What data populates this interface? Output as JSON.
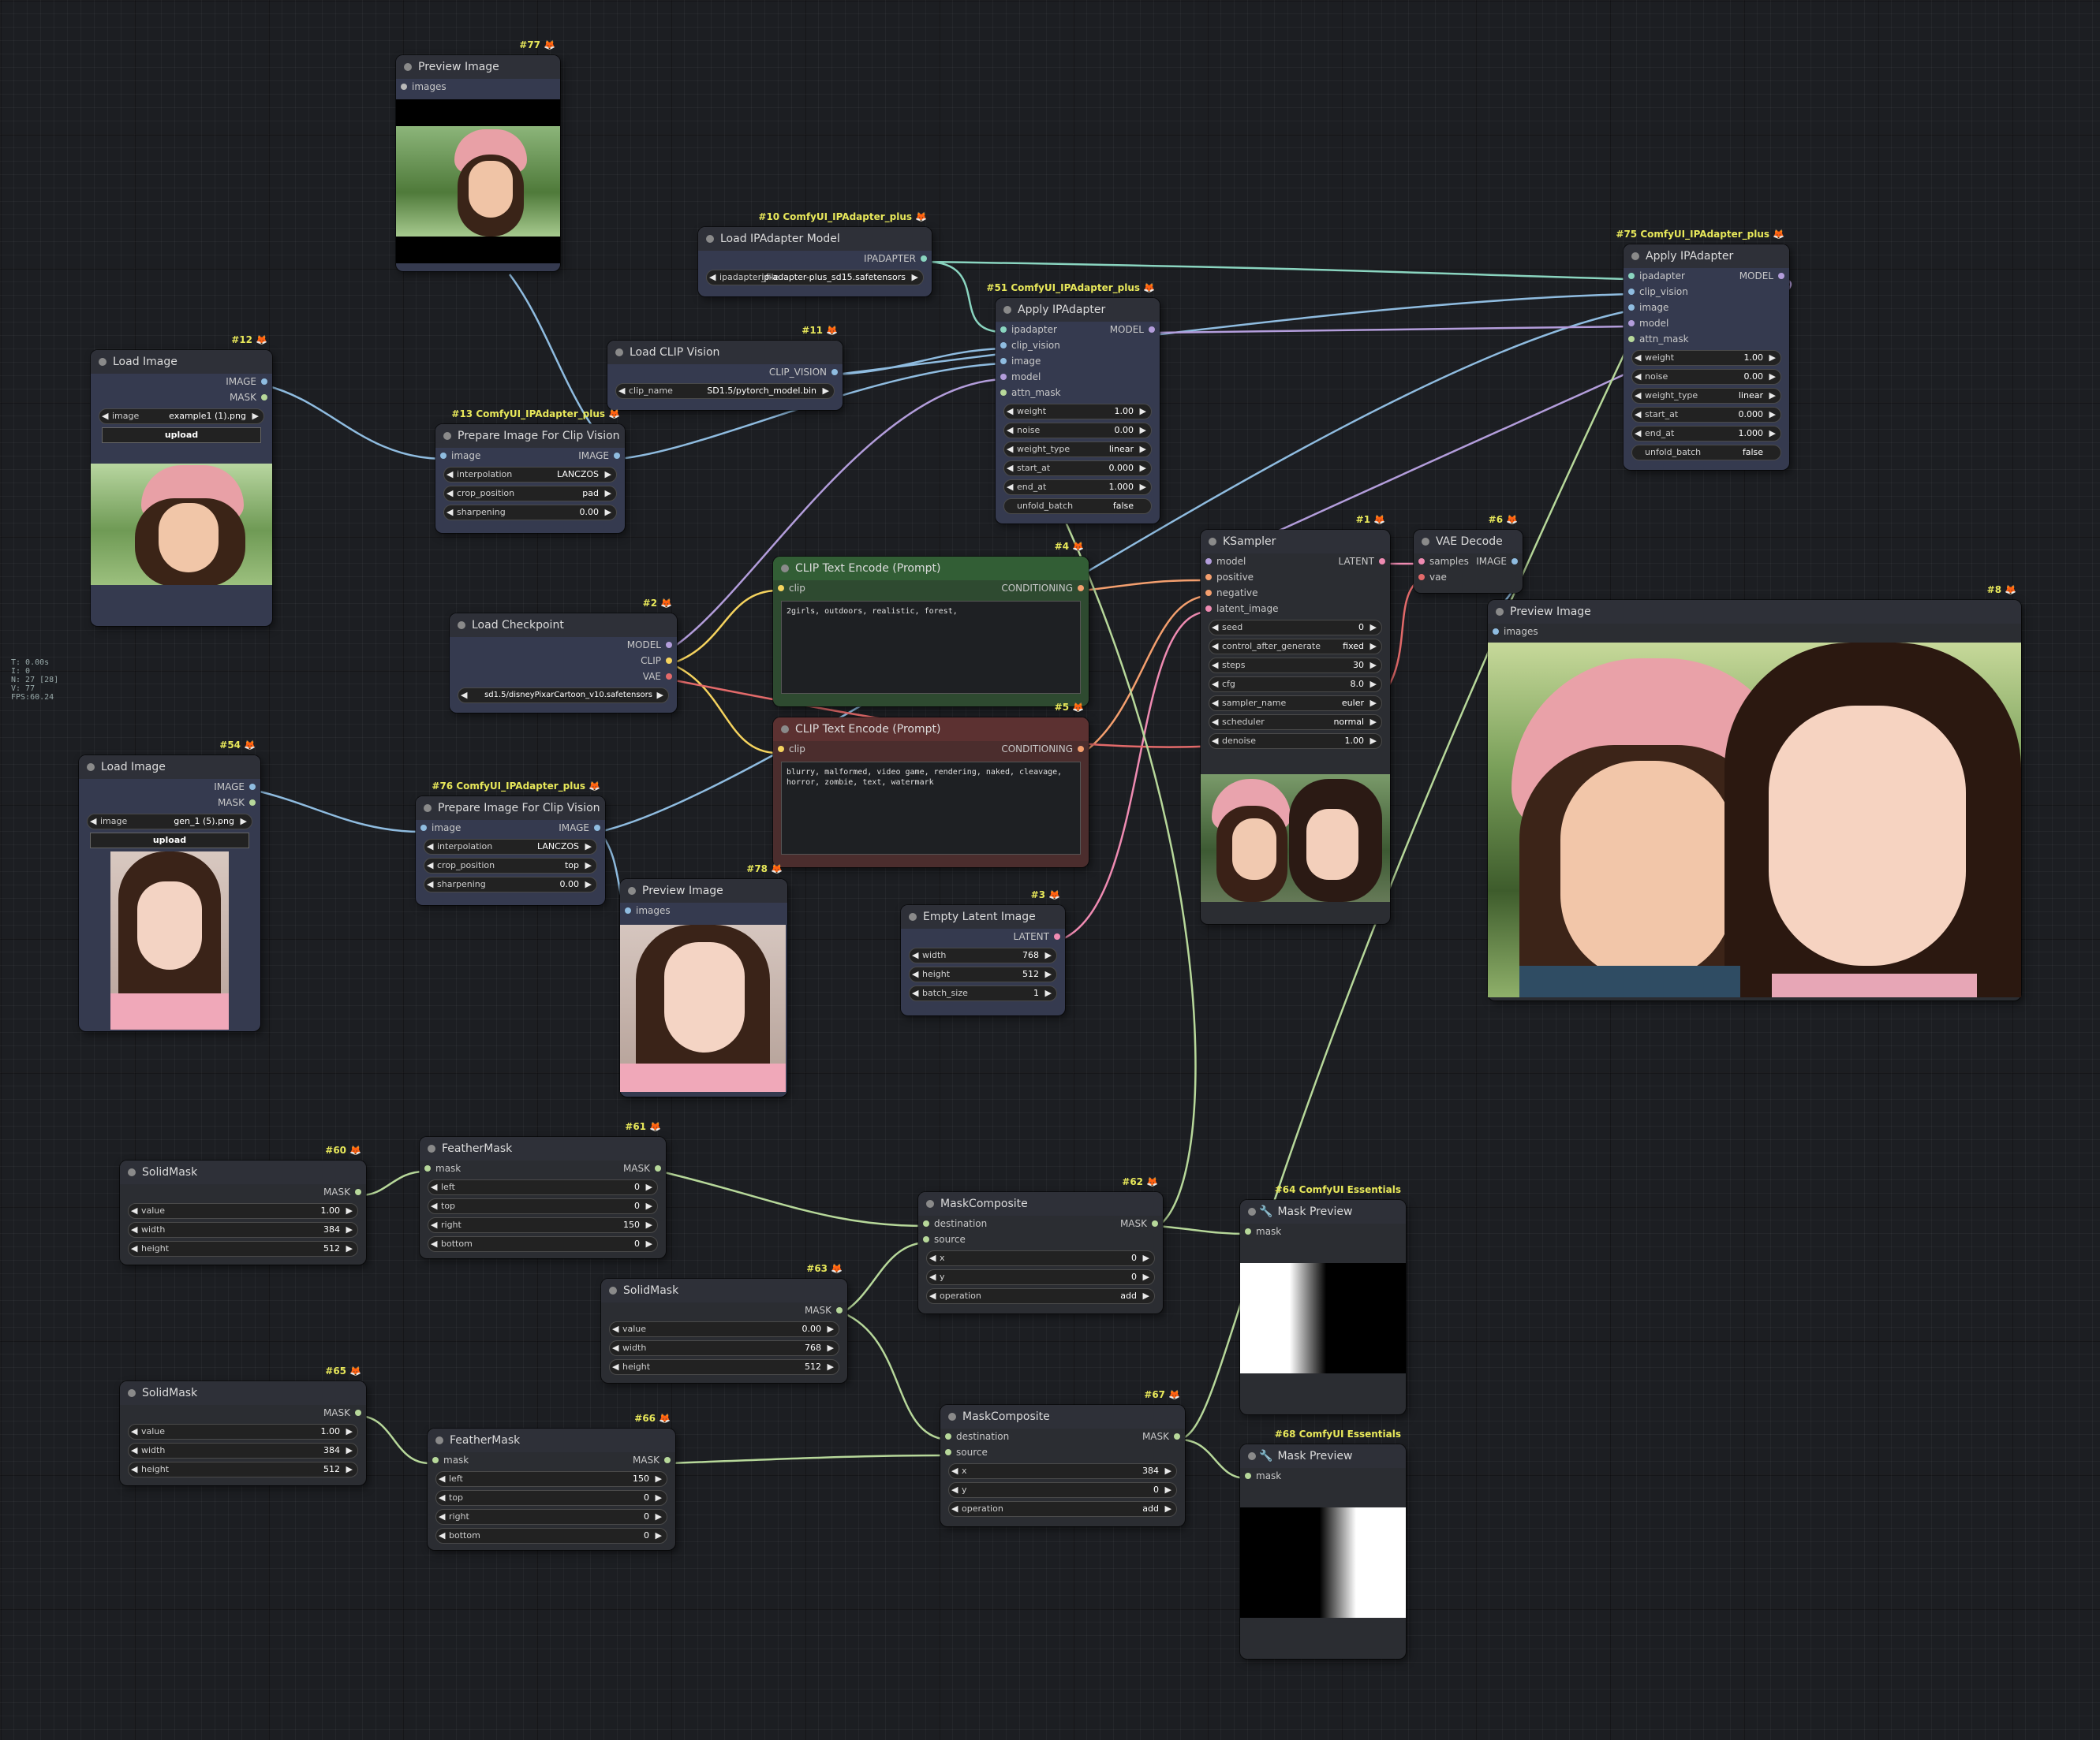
{
  "stats": [
    "T: 0.00s",
    "I: 0",
    "N: 27 [28]",
    "V: 77",
    "FPS:60.24"
  ],
  "colors": {
    "canvas": "#1c1e22",
    "node_body": "#353a4f",
    "node_title": "#2e3038",
    "id_badge": "#e8e85a",
    "link_image": "#8fbce0",
    "link_model": "#b39ddb",
    "link_clip": "#f5d35e",
    "link_conditioning": "#f49f6e",
    "link_latent": "#ef8bb2",
    "link_mask": "#b7d89a",
    "link_ipadapter": "#8ad5c0"
  },
  "nodes": {
    "n77": {
      "id": "#77",
      "title": "Preview Image",
      "in0": "images"
    },
    "n10": {
      "id": "#10 ComfyUI_IPAdapter_plus",
      "title": "Load IPAdapter Model",
      "out0": "IPADAPTER",
      "w_label": "ipadapter_file",
      "w_value": "ip-adapter-plus_sd15.safetensors"
    },
    "n51": {
      "id": "#51 ComfyUI_IPAdapter_plus",
      "title": "Apply IPAdapter",
      "in": [
        "ipadapter",
        "clip_vision",
        "image",
        "model",
        "attn_mask"
      ],
      "out0": "MODEL",
      "widgets": [
        {
          "l": "weight",
          "v": "1.00"
        },
        {
          "l": "noise",
          "v": "0.00"
        },
        {
          "l": "weight_type",
          "v": "linear"
        },
        {
          "l": "start_at",
          "v": "0.000"
        },
        {
          "l": "end_at",
          "v": "1.000"
        }
      ],
      "toggle_l": "unfold_batch",
      "toggle_v": "false"
    },
    "n75": {
      "id": "#75 ComfyUI_IPAdapter_plus",
      "title": "Apply IPAdapter",
      "in": [
        "ipadapter",
        "clip_vision",
        "image",
        "model",
        "attn_mask"
      ],
      "out0": "MODEL",
      "widgets": [
        {
          "l": "weight",
          "v": "1.00"
        },
        {
          "l": "noise",
          "v": "0.00"
        },
        {
          "l": "weight_type",
          "v": "linear"
        },
        {
          "l": "start_at",
          "v": "0.000"
        },
        {
          "l": "end_at",
          "v": "1.000"
        }
      ],
      "toggle_l": "unfold_batch",
      "toggle_v": "false"
    },
    "n11": {
      "id": "#11",
      "title": "Load CLIP Vision",
      "out0": "CLIP_VISION",
      "w_label": "clip_name",
      "w_value": "SD1.5/pytorch_model.bin"
    },
    "n12": {
      "id": "#12",
      "title": "Load Image",
      "out0": "IMAGE",
      "out1": "MASK",
      "w_label": "image",
      "w_value": "example1 (1).png",
      "upload": "upload"
    },
    "n13": {
      "id": "#13 ComfyUI_IPAdapter_plus",
      "title": "Prepare Image For Clip Vision",
      "in0": "image",
      "out0": "IMAGE",
      "widgets": [
        {
          "l": "interpolation",
          "v": "LANCZOS"
        },
        {
          "l": "crop_position",
          "v": "pad"
        },
        {
          "l": "sharpening",
          "v": "0.00"
        }
      ]
    },
    "n2": {
      "id": "#2",
      "title": "Load Checkpoint",
      "out": [
        "MODEL",
        "CLIP",
        "VAE"
      ],
      "w_label": "ckpt_name",
      "w_value": "sd1.5/disneyPixarCartoon_v10.safetensors"
    },
    "n4": {
      "id": "#4",
      "title": "CLIP Text Encode (Prompt)",
      "in0": "clip",
      "out0": "CONDITIONING",
      "text": "2girls, outdoors, realistic, forest,"
    },
    "n5": {
      "id": "#5",
      "title": "CLIP Text Encode (Prompt)",
      "in0": "clip",
      "out0": "CONDITIONING",
      "text": "blurry, malformed, video game, rendering, naked, cleavage, horror, zombie, text, watermark"
    },
    "n1": {
      "id": "#1",
      "title": "KSampler",
      "in": [
        "model",
        "positive",
        "negative",
        "latent_image"
      ],
      "out0": "LATENT",
      "widgets": [
        {
          "l": "seed",
          "v": "0"
        },
        {
          "l": "control_after_generate",
          "v": "fixed"
        },
        {
          "l": "steps",
          "v": "30"
        },
        {
          "l": "cfg",
          "v": "8.0"
        },
        {
          "l": "sampler_name",
          "v": "euler"
        },
        {
          "l": "scheduler",
          "v": "normal"
        },
        {
          "l": "denoise",
          "v": "1.00"
        }
      ]
    },
    "n6": {
      "id": "#6",
      "title": "VAE Decode",
      "in": [
        "samples",
        "vae"
      ],
      "out0": "IMAGE"
    },
    "n8": {
      "id": "#8",
      "title": "Preview Image",
      "in0": "images"
    },
    "n54": {
      "id": "#54",
      "title": "Load Image",
      "out0": "IMAGE",
      "out1": "MASK",
      "w_label": "image",
      "w_value": "gen_1 (5).png",
      "upload": "upload"
    },
    "n76": {
      "id": "#76 ComfyUI_IPAdapter_plus",
      "title": "Prepare Image For Clip Vision",
      "in0": "image",
      "out0": "IMAGE",
      "widgets": [
        {
          "l": "interpolation",
          "v": "LANCZOS"
        },
        {
          "l": "crop_position",
          "v": "top"
        },
        {
          "l": "sharpening",
          "v": "0.00"
        }
      ]
    },
    "n78": {
      "id": "#78",
      "title": "Preview Image",
      "in0": "images"
    },
    "n3": {
      "id": "#3",
      "title": "Empty Latent Image",
      "out0": "LATENT",
      "widgets": [
        {
          "l": "width",
          "v": "768"
        },
        {
          "l": "height",
          "v": "512"
        },
        {
          "l": "batch_size",
          "v": "1"
        }
      ]
    },
    "n60": {
      "id": "#60",
      "title": "SolidMask",
      "out0": "MASK",
      "widgets": [
        {
          "l": "value",
          "v": "1.00"
        },
        {
          "l": "width",
          "v": "384"
        },
        {
          "l": "height",
          "v": "512"
        }
      ]
    },
    "n61": {
      "id": "#61",
      "title": "FeatherMask",
      "in0": "mask",
      "out0": "MASK",
      "widgets": [
        {
          "l": "left",
          "v": "0"
        },
        {
          "l": "top",
          "v": "0"
        },
        {
          "l": "right",
          "v": "150"
        },
        {
          "l": "bottom",
          "v": "0"
        }
      ]
    },
    "n62": {
      "id": "#62",
      "title": "MaskComposite",
      "in": [
        "destination",
        "source"
      ],
      "out0": "MASK",
      "widgets": [
        {
          "l": "x",
          "v": "0"
        },
        {
          "l": "y",
          "v": "0"
        },
        {
          "l": "operation",
          "v": "add"
        }
      ]
    },
    "n63": {
      "id": "#63",
      "title": "SolidMask",
      "out0": "MASK",
      "widgets": [
        {
          "l": "value",
          "v": "0.00"
        },
        {
          "l": "width",
          "v": "768"
        },
        {
          "l": "height",
          "v": "512"
        }
      ]
    },
    "n64": {
      "id": "#64 ComfyUI Essentials",
      "title": "Mask Preview",
      "in0": "mask"
    },
    "n65": {
      "id": "#65",
      "title": "SolidMask",
      "out0": "MASK",
      "widgets": [
        {
          "l": "value",
          "v": "1.00"
        },
        {
          "l": "width",
          "v": "384"
        },
        {
          "l": "height",
          "v": "512"
        }
      ]
    },
    "n66": {
      "id": "#66",
      "title": "FeatherMask",
      "in0": "mask",
      "out0": "MASK",
      "widgets": [
        {
          "l": "left",
          "v": "150"
        },
        {
          "l": "top",
          "v": "0"
        },
        {
          "l": "right",
          "v": "0"
        },
        {
          "l": "bottom",
          "v": "0"
        }
      ]
    },
    "n67": {
      "id": "#67",
      "title": "MaskComposite",
      "in": [
        "destination",
        "source"
      ],
      "out0": "MASK",
      "widgets": [
        {
          "l": "x",
          "v": "384"
        },
        {
          "l": "y",
          "v": "0"
        },
        {
          "l": "operation",
          "v": "add"
        }
      ]
    },
    "n68": {
      "id": "#68 ComfyUI Essentials",
      "title": "Mask Preview",
      "in0": "mask"
    }
  }
}
